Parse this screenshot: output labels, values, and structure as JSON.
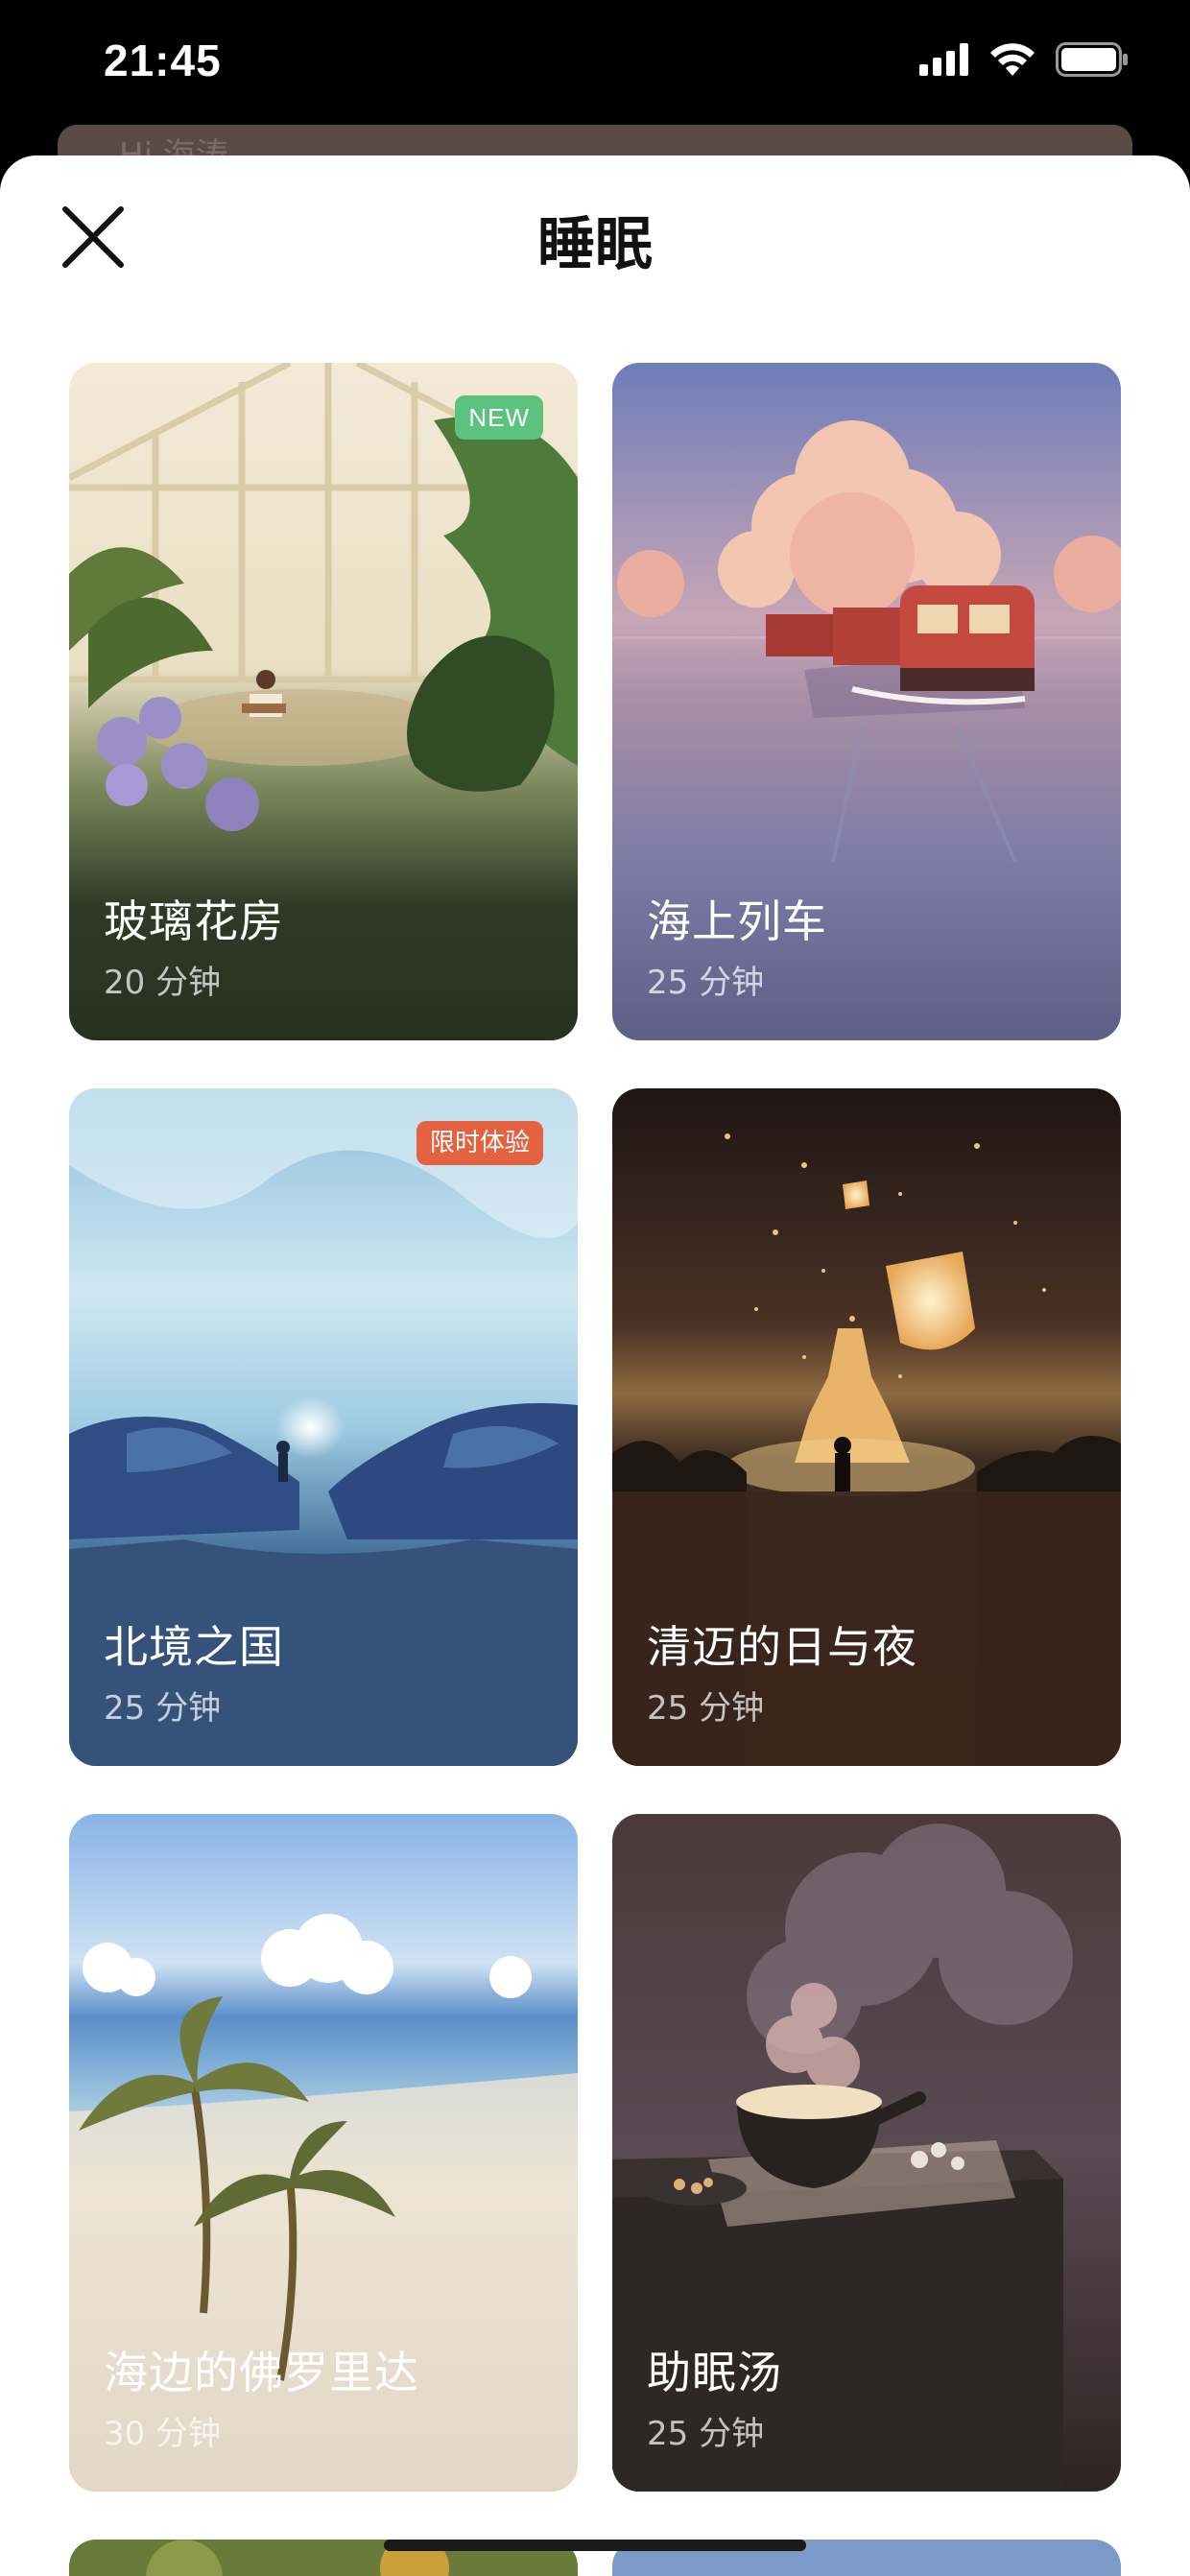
{
  "status": {
    "time": "21:45"
  },
  "background_sheet": {
    "hint": "Hi 海涛"
  },
  "header": {
    "title": "睡眠",
    "close_icon": "close-icon"
  },
  "cards": [
    {
      "title": "玻璃花房",
      "duration": "20 分钟",
      "badge": "NEW",
      "theme": "greenhouse"
    },
    {
      "title": "海上列车",
      "duration": "25 分钟",
      "badge": "",
      "theme": "sea-train"
    },
    {
      "title": "北境之国",
      "duration": "25 分钟",
      "badge": "限时体验",
      "theme": "ice-cave"
    },
    {
      "title": "清迈的日与夜",
      "duration": "25 分钟",
      "badge": "",
      "theme": "lanterns"
    },
    {
      "title": "海边的佛罗里达",
      "duration": "30 分钟",
      "badge": "",
      "theme": "beach"
    },
    {
      "title": "助眠汤",
      "duration": "25 分钟",
      "badge": "",
      "theme": "soup"
    }
  ],
  "colors": {
    "greenhouse_bottom": "#28301f",
    "sea_train_bottom": "#5d5f85",
    "ice_cave_bottom": "#35527a",
    "lanterns_bottom": "#3b261c",
    "beach_bottom": "#b3a693",
    "soup_bottom": "#2d2424",
    "badge_new": "#5cc37e",
    "badge_limited": "#e4623f"
  }
}
